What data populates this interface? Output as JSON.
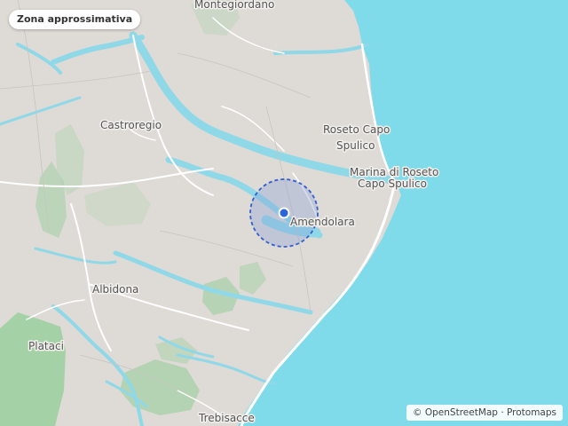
{
  "map": {
    "title": "Zona approssimativa",
    "attribution": "© OpenStreetMap · Protomaps",
    "colors": {
      "land": "#dedad6",
      "sea": "#7fdbea",
      "river": "#8fd8e8",
      "forest": "#9bcf9f",
      "road": "#ffffff",
      "accuracy_fill": "#8aa0d8",
      "accuracy_stroke": "#2f5fd0",
      "marker": "#2a66d9"
    },
    "places": [
      {
        "id": "montegiordano",
        "name": "Montegiordano"
      },
      {
        "id": "castroregio",
        "name": "Castroregio"
      },
      {
        "id": "roseto-1",
        "name": "Roseto Capo"
      },
      {
        "id": "roseto-2",
        "name": "Spulico"
      },
      {
        "id": "marina-1",
        "name": "Marina di Roseto"
      },
      {
        "id": "marina-2",
        "name": "Capo Spulico"
      },
      {
        "id": "amendolara",
        "name": "Amendolara"
      },
      {
        "id": "albidona",
        "name": "Albidona"
      },
      {
        "id": "plataci",
        "name": "Plataci"
      },
      {
        "id": "trebisacce",
        "name": "Trebisacce"
      }
    ]
  }
}
